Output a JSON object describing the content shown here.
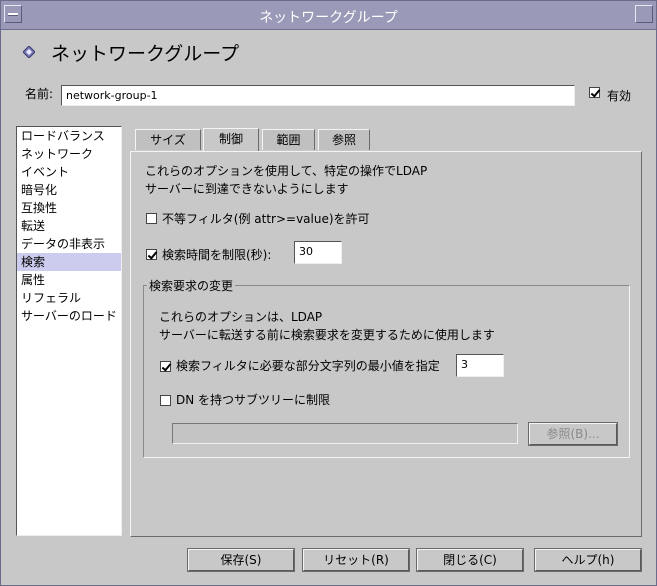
{
  "window": {
    "title": "ネットワークグループ"
  },
  "header": {
    "title": "ネットワークグループ"
  },
  "name_field": {
    "label": "名前:",
    "value": "network-group-1"
  },
  "enabled": {
    "label": "有効",
    "checked": true
  },
  "sidebar": {
    "items": [
      {
        "label": "ロードバランス"
      },
      {
        "label": "ネットワーク"
      },
      {
        "label": "イベント"
      },
      {
        "label": "暗号化"
      },
      {
        "label": "互換性"
      },
      {
        "label": "転送"
      },
      {
        "label": "データの非表示"
      },
      {
        "label": "検索",
        "selected": true
      },
      {
        "label": "属性"
      },
      {
        "label": "リフェラル"
      },
      {
        "label": "サーバーのロード"
      }
    ]
  },
  "tabs": [
    {
      "label": "サイズ"
    },
    {
      "label": "制御",
      "active": true
    },
    {
      "label": "範囲"
    },
    {
      "label": "参照"
    }
  ],
  "panel": {
    "description_line1": "これらのオプションを使用して、特定の操作でLDAP",
    "description_line2": "サーバーに到達できないようにします",
    "allow_inequality": {
      "label": "不等フィルタ(例 attr>=value)を許可",
      "checked": false
    },
    "limit_search_time": {
      "label": "検索時間を制限(秒):",
      "checked": true,
      "value": "30"
    },
    "search_request_group": {
      "title": "検索要求の変更",
      "description_line1": "これらのオプションは、LDAP",
      "description_line2": "サーバーに転送する前に検索要求を変更するために使用します",
      "min_substring": {
        "label": "検索フィルタに必要な部分文字列の最小値を指定",
        "checked": true,
        "value": "3"
      },
      "limit_subtree": {
        "label": "DN を持つサブツリーに制限",
        "checked": false,
        "value": ""
      },
      "browse_label": "参照(B)..."
    }
  },
  "footer": {
    "save": "保存(S)",
    "reset": "リセット(R)",
    "close": "閉じる(C)",
    "help": "ヘルプ(h)"
  }
}
